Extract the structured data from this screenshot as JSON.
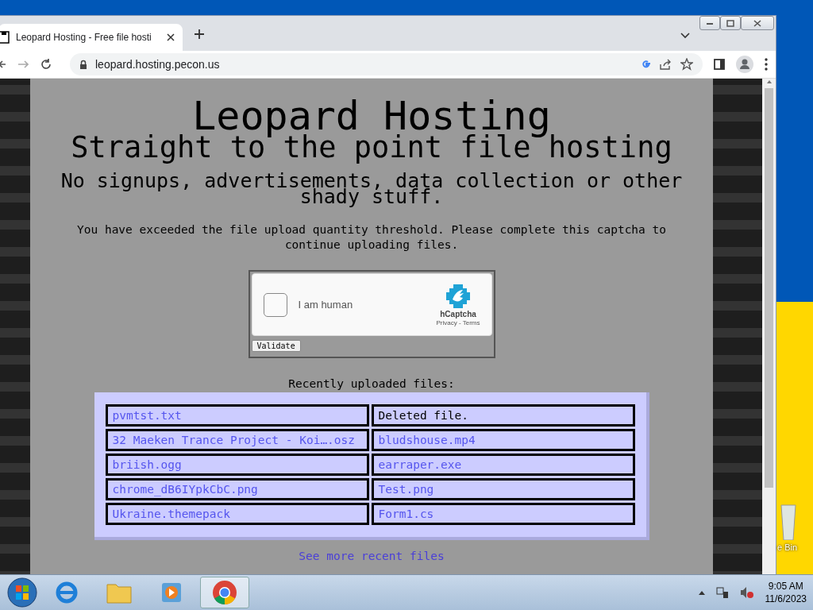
{
  "desktop": {
    "recycle_label": "e Bin"
  },
  "browser": {
    "tab": {
      "title": "Leopard Hosting - Free file hosti",
      "selected": true
    },
    "address": "leopard.hosting.pecon.us"
  },
  "page": {
    "title": "Leopard Hosting",
    "tagline": "Straight to the point file hosting",
    "subtitle": "No signups, advertisements, data collection or other shady stuff.",
    "notice": "You have exceeded the file upload quantity threshold. Please complete this captcha to continue uploading files.",
    "captcha": {
      "label": "I am human",
      "checked": false,
      "brand": "hCaptcha",
      "links": "Privacy - Terms"
    },
    "validate_button": "Validate",
    "recent_heading": "Recently uploaded files:",
    "files": [
      {
        "kind": "link",
        "name": "pvmtst.txt"
      },
      {
        "kind": "deleted",
        "name": "Deleted file."
      },
      {
        "kind": "link",
        "name": "32 Maeken Trance Project - Koi….osz"
      },
      {
        "kind": "link",
        "name": "bludshouse.mp4"
      },
      {
        "kind": "link",
        "name": "briish.ogg"
      },
      {
        "kind": "link",
        "name": "earraper.exe"
      },
      {
        "kind": "link",
        "name": "chrome_dB6IYpkCbC.png"
      },
      {
        "kind": "link",
        "name": "Test.png"
      },
      {
        "kind": "link",
        "name": "Ukraine.themepack"
      },
      {
        "kind": "link",
        "name": "Form1.cs"
      }
    ],
    "more_link": "See more recent files"
  },
  "taskbar": {
    "apps": [
      {
        "kind": "browser-e",
        "selected": false
      },
      {
        "kind": "folder",
        "selected": false
      },
      {
        "kind": "media",
        "selected": false
      },
      {
        "kind": "chrome",
        "selected": true
      }
    ],
    "time": "9:05 AM",
    "date": "11/6/2023"
  }
}
